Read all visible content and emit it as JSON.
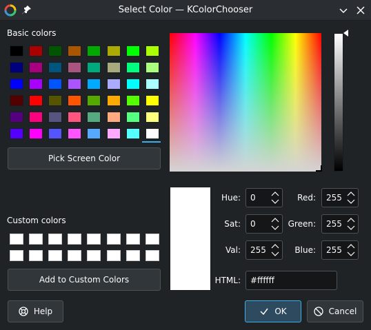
{
  "window": {
    "title": "Select Color — KColorChooser",
    "minimize_icon": "chevron-down-icon",
    "close_icon": "close-icon"
  },
  "basic_colors": {
    "label": "Basic colors",
    "rows": [
      [
        "#000000",
        "#aa0000",
        "#005500",
        "#aa5500",
        "#00aa00",
        "#aaaa00",
        "#00ff00",
        "#aaff00"
      ],
      [
        "#00007f",
        "#aa007f",
        "#00557f",
        "#aa557f",
        "#00aa7f",
        "#aaaa7f",
        "#00ff7f",
        "#aaff7f"
      ],
      [
        "#0000ff",
        "#aa00ff",
        "#0055ff",
        "#aa55ff",
        "#00aaff",
        "#aaaaff",
        "#00ffff",
        "#aaffff"
      ],
      [
        "#550000",
        "#ff0000",
        "#555500",
        "#ff5500",
        "#55aa00",
        "#ffaa00",
        "#55ff00",
        "#ffff00"
      ],
      [
        "#55007f",
        "#ff007f",
        "#55557f",
        "#ff557f",
        "#55aa7f",
        "#ffaa7f",
        "#55ff7f",
        "#ffff7f"
      ],
      [
        "#5500ff",
        "#ff00ff",
        "#5555ff",
        "#ff55ff",
        "#55aaff",
        "#ffaaff",
        "#55ffff",
        "#ffffff"
      ]
    ]
  },
  "pick_screen_color": "Pick Screen Color",
  "custom_colors": {
    "label": "Custom colors",
    "color": "#ffffff"
  },
  "add_to_custom": "Add to Custom Colors",
  "fields": {
    "hue": {
      "label": "Hue:",
      "value": "0"
    },
    "sat": {
      "label": "Sat:",
      "value": "0"
    },
    "val": {
      "label": "Val:",
      "value": "255"
    },
    "red": {
      "label": "Red:",
      "value": "255"
    },
    "green": {
      "label": "Green:",
      "value": "255"
    },
    "blue": {
      "label": "Blue:",
      "value": "255"
    },
    "html": {
      "label": "HTML:",
      "value": "#ffffff"
    }
  },
  "current_color": "#ffffff",
  "buttons": {
    "help": "Help",
    "ok": "OK",
    "cancel": "Cancel"
  },
  "accent": "#3daee9"
}
